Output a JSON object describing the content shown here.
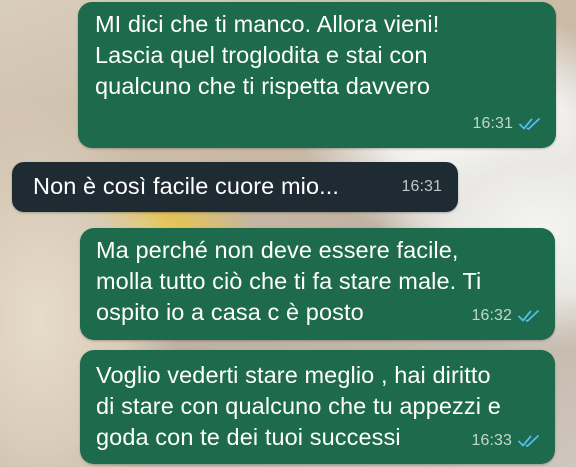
{
  "chat": {
    "messages": [
      {
        "direction": "outgoing",
        "text": "MI dici che ti manco. Allora vieni!\nLascia quel troglodita e stai con\nqualcuno che ti rispetta davvero",
        "time": "16:31",
        "status": "read"
      },
      {
        "direction": "incoming",
        "text": "Non è così facile cuore mio...",
        "time": "16:31"
      },
      {
        "direction": "outgoing",
        "text": "Ma perché non deve essere facile,\nmolla tutto ciò che ti fa stare male. Ti\nospito io a casa c è posto",
        "time": "16:32",
        "status": "read"
      },
      {
        "direction": "outgoing",
        "text": "Voglio vederti stare meglio , hai diritto\ndi stare con qualcuno che tu appezzi e\ngoda con te dei tuoi successi",
        "time": "16:33",
        "status": "read"
      }
    ]
  },
  "colors": {
    "outgoing_bubble": "#1d6b4c",
    "incoming_bubble": "#1f2b33",
    "read_ticks": "#53bdeb"
  },
  "icons": {
    "read_receipt": "double-check-icon"
  }
}
